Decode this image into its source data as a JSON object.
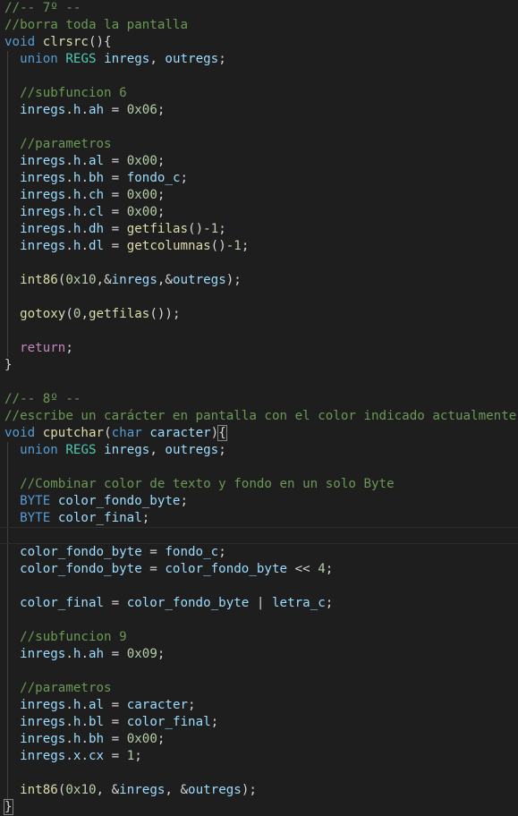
{
  "colors": {
    "background": "#1e1e1e",
    "plain": "#d4d4d4",
    "comment": "#6a9955",
    "keyword": "#569cd6",
    "type": "#4ec9b0",
    "function": "#dcdcaa",
    "variable": "#9cdcfe",
    "number": "#b5cea8",
    "control": "#c586c0"
  },
  "editor": {
    "lines": [
      {
        "tokens": [
          {
            "t": "//-- 7º --",
            "c": "comment"
          }
        ]
      },
      {
        "tokens": [
          {
            "t": "//borra toda la pantalla",
            "c": "comment"
          }
        ]
      },
      {
        "tokens": [
          {
            "t": "void",
            "c": "keyword"
          },
          {
            "t": " ",
            "c": "plain"
          },
          {
            "t": "clrsrc",
            "c": "function"
          },
          {
            "t": "(){",
            "c": "plain"
          }
        ]
      },
      {
        "guide": true,
        "tokens": [
          {
            "t": "  ",
            "c": "plain"
          },
          {
            "t": "union",
            "c": "keyword"
          },
          {
            "t": " ",
            "c": "plain"
          },
          {
            "t": "REGS",
            "c": "type"
          },
          {
            "t": " ",
            "c": "plain"
          },
          {
            "t": "inregs",
            "c": "variable"
          },
          {
            "t": ", ",
            "c": "plain"
          },
          {
            "t": "outregs",
            "c": "variable"
          },
          {
            "t": ";",
            "c": "plain"
          }
        ]
      },
      {
        "guide": true,
        "tokens": []
      },
      {
        "guide": true,
        "tokens": [
          {
            "t": "  ",
            "c": "plain"
          },
          {
            "t": "//subfuncion 6",
            "c": "comment"
          }
        ]
      },
      {
        "guide": true,
        "tokens": [
          {
            "t": "  ",
            "c": "plain"
          },
          {
            "t": "inregs",
            "c": "variable"
          },
          {
            "t": ".",
            "c": "plain"
          },
          {
            "t": "h",
            "c": "variable"
          },
          {
            "t": ".",
            "c": "plain"
          },
          {
            "t": "ah",
            "c": "variable"
          },
          {
            "t": " = ",
            "c": "plain"
          },
          {
            "t": "0x06",
            "c": "number"
          },
          {
            "t": ";",
            "c": "plain"
          }
        ]
      },
      {
        "guide": true,
        "tokens": []
      },
      {
        "guide": true,
        "tokens": [
          {
            "t": "  ",
            "c": "plain"
          },
          {
            "t": "//parametros",
            "c": "comment"
          }
        ]
      },
      {
        "guide": true,
        "tokens": [
          {
            "t": "  ",
            "c": "plain"
          },
          {
            "t": "inregs",
            "c": "variable"
          },
          {
            "t": ".",
            "c": "plain"
          },
          {
            "t": "h",
            "c": "variable"
          },
          {
            "t": ".",
            "c": "plain"
          },
          {
            "t": "al",
            "c": "variable"
          },
          {
            "t": " = ",
            "c": "plain"
          },
          {
            "t": "0x00",
            "c": "number"
          },
          {
            "t": ";",
            "c": "plain"
          }
        ]
      },
      {
        "guide": true,
        "tokens": [
          {
            "t": "  ",
            "c": "plain"
          },
          {
            "t": "inregs",
            "c": "variable"
          },
          {
            "t": ".",
            "c": "plain"
          },
          {
            "t": "h",
            "c": "variable"
          },
          {
            "t": ".",
            "c": "plain"
          },
          {
            "t": "bh",
            "c": "variable"
          },
          {
            "t": " = ",
            "c": "plain"
          },
          {
            "t": "fondo_c",
            "c": "variable"
          },
          {
            "t": ";",
            "c": "plain"
          }
        ]
      },
      {
        "guide": true,
        "tokens": [
          {
            "t": "  ",
            "c": "plain"
          },
          {
            "t": "inregs",
            "c": "variable"
          },
          {
            "t": ".",
            "c": "plain"
          },
          {
            "t": "h",
            "c": "variable"
          },
          {
            "t": ".",
            "c": "plain"
          },
          {
            "t": "ch",
            "c": "variable"
          },
          {
            "t": " = ",
            "c": "plain"
          },
          {
            "t": "0x00",
            "c": "number"
          },
          {
            "t": ";",
            "c": "plain"
          }
        ]
      },
      {
        "guide": true,
        "tokens": [
          {
            "t": "  ",
            "c": "plain"
          },
          {
            "t": "inregs",
            "c": "variable"
          },
          {
            "t": ".",
            "c": "plain"
          },
          {
            "t": "h",
            "c": "variable"
          },
          {
            "t": ".",
            "c": "plain"
          },
          {
            "t": "cl",
            "c": "variable"
          },
          {
            "t": " = ",
            "c": "plain"
          },
          {
            "t": "0x00",
            "c": "number"
          },
          {
            "t": ";",
            "c": "plain"
          }
        ]
      },
      {
        "guide": true,
        "tokens": [
          {
            "t": "  ",
            "c": "plain"
          },
          {
            "t": "inregs",
            "c": "variable"
          },
          {
            "t": ".",
            "c": "plain"
          },
          {
            "t": "h",
            "c": "variable"
          },
          {
            "t": ".",
            "c": "plain"
          },
          {
            "t": "dh",
            "c": "variable"
          },
          {
            "t": " = ",
            "c": "plain"
          },
          {
            "t": "getfilas",
            "c": "function"
          },
          {
            "t": "()-",
            "c": "plain"
          },
          {
            "t": "1",
            "c": "number"
          },
          {
            "t": ";",
            "c": "plain"
          }
        ]
      },
      {
        "guide": true,
        "tokens": [
          {
            "t": "  ",
            "c": "plain"
          },
          {
            "t": "inregs",
            "c": "variable"
          },
          {
            "t": ".",
            "c": "plain"
          },
          {
            "t": "h",
            "c": "variable"
          },
          {
            "t": ".",
            "c": "plain"
          },
          {
            "t": "dl",
            "c": "variable"
          },
          {
            "t": " = ",
            "c": "plain"
          },
          {
            "t": "getcolumnas",
            "c": "function"
          },
          {
            "t": "()-",
            "c": "plain"
          },
          {
            "t": "1",
            "c": "number"
          },
          {
            "t": ";",
            "c": "plain"
          }
        ]
      },
      {
        "guide": true,
        "tokens": []
      },
      {
        "guide": true,
        "tokens": [
          {
            "t": "  ",
            "c": "plain"
          },
          {
            "t": "int86",
            "c": "function"
          },
          {
            "t": "(",
            "c": "plain"
          },
          {
            "t": "0x10",
            "c": "number"
          },
          {
            "t": ",&",
            "c": "plain"
          },
          {
            "t": "inregs",
            "c": "variable"
          },
          {
            "t": ",&",
            "c": "plain"
          },
          {
            "t": "outregs",
            "c": "variable"
          },
          {
            "t": ");",
            "c": "plain"
          }
        ]
      },
      {
        "guide": true,
        "tokens": []
      },
      {
        "guide": true,
        "tokens": [
          {
            "t": "  ",
            "c": "plain"
          },
          {
            "t": "gotoxy",
            "c": "function"
          },
          {
            "t": "(",
            "c": "plain"
          },
          {
            "t": "0",
            "c": "number"
          },
          {
            "t": ",",
            "c": "plain"
          },
          {
            "t": "getfilas",
            "c": "function"
          },
          {
            "t": "());",
            "c": "plain"
          }
        ]
      },
      {
        "guide": true,
        "tokens": []
      },
      {
        "guide": true,
        "tokens": [
          {
            "t": "  ",
            "c": "plain"
          },
          {
            "t": "return",
            "c": "control"
          },
          {
            "t": ";",
            "c": "plain"
          }
        ]
      },
      {
        "tokens": [
          {
            "t": "}",
            "c": "plain"
          }
        ]
      },
      {
        "tokens": []
      },
      {
        "tokens": [
          {
            "t": "//-- 8º --",
            "c": "comment"
          }
        ]
      },
      {
        "tokens": [
          {
            "t": "//escribe un carácter en pantalla con el color indicado actualmente",
            "c": "comment"
          }
        ]
      },
      {
        "tokens": [
          {
            "t": "void",
            "c": "keyword"
          },
          {
            "t": " ",
            "c": "plain"
          },
          {
            "t": "cputchar",
            "c": "function"
          },
          {
            "t": "(",
            "c": "plain"
          },
          {
            "t": "char",
            "c": "keyword"
          },
          {
            "t": " ",
            "c": "plain"
          },
          {
            "t": "caracter",
            "c": "variable"
          },
          {
            "t": ")",
            "c": "plain"
          },
          {
            "t": "{",
            "c": "plain",
            "match": true
          }
        ]
      },
      {
        "guide": true,
        "tokens": [
          {
            "t": "  ",
            "c": "plain"
          },
          {
            "t": "union",
            "c": "keyword"
          },
          {
            "t": " ",
            "c": "plain"
          },
          {
            "t": "REGS",
            "c": "type"
          },
          {
            "t": " ",
            "c": "plain"
          },
          {
            "t": "inregs",
            "c": "variable"
          },
          {
            "t": ", ",
            "c": "plain"
          },
          {
            "t": "outregs",
            "c": "variable"
          },
          {
            "t": ";",
            "c": "plain"
          }
        ]
      },
      {
        "guide": true,
        "tokens": []
      },
      {
        "guide": true,
        "tokens": [
          {
            "t": "  ",
            "c": "plain"
          },
          {
            "t": "//Combinar color de texto y fondo en un solo Byte",
            "c": "comment"
          }
        ]
      },
      {
        "guide": true,
        "tokens": [
          {
            "t": "  ",
            "c": "plain"
          },
          {
            "t": "BYTE",
            "c": "keyword"
          },
          {
            "t": " ",
            "c": "plain"
          },
          {
            "t": "color_fondo_byte",
            "c": "variable"
          },
          {
            "t": ";",
            "c": "plain"
          }
        ]
      },
      {
        "guide": true,
        "tokens": [
          {
            "t": "  ",
            "c": "plain"
          },
          {
            "t": "BYTE",
            "c": "keyword"
          },
          {
            "t": " ",
            "c": "plain"
          },
          {
            "t": "color_final",
            "c": "variable"
          },
          {
            "t": ";",
            "c": "plain"
          }
        ]
      },
      {
        "guide": true,
        "current": true,
        "tokens": []
      },
      {
        "guide": true,
        "tokens": [
          {
            "t": "  ",
            "c": "plain"
          },
          {
            "t": "color_fondo_byte",
            "c": "variable"
          },
          {
            "t": " = ",
            "c": "plain"
          },
          {
            "t": "fondo_c",
            "c": "variable"
          },
          {
            "t": ";",
            "c": "plain"
          }
        ]
      },
      {
        "guide": true,
        "tokens": [
          {
            "t": "  ",
            "c": "plain"
          },
          {
            "t": "color_fondo_byte",
            "c": "variable"
          },
          {
            "t": " = ",
            "c": "plain"
          },
          {
            "t": "color_fondo_byte",
            "c": "variable"
          },
          {
            "t": " << ",
            "c": "plain"
          },
          {
            "t": "4",
            "c": "number"
          },
          {
            "t": ";",
            "c": "plain"
          }
        ]
      },
      {
        "guide": true,
        "tokens": []
      },
      {
        "guide": true,
        "tokens": [
          {
            "t": "  ",
            "c": "plain"
          },
          {
            "t": "color_final",
            "c": "variable"
          },
          {
            "t": " = ",
            "c": "plain"
          },
          {
            "t": "color_fondo_byte",
            "c": "variable"
          },
          {
            "t": " | ",
            "c": "plain"
          },
          {
            "t": "letra_c",
            "c": "variable"
          },
          {
            "t": ";",
            "c": "plain"
          }
        ]
      },
      {
        "guide": true,
        "tokens": []
      },
      {
        "guide": true,
        "tokens": [
          {
            "t": "  ",
            "c": "plain"
          },
          {
            "t": "//subfuncion 9",
            "c": "comment"
          }
        ]
      },
      {
        "guide": true,
        "tokens": [
          {
            "t": "  ",
            "c": "plain"
          },
          {
            "t": "inregs",
            "c": "variable"
          },
          {
            "t": ".",
            "c": "plain"
          },
          {
            "t": "h",
            "c": "variable"
          },
          {
            "t": ".",
            "c": "plain"
          },
          {
            "t": "ah",
            "c": "variable"
          },
          {
            "t": " = ",
            "c": "plain"
          },
          {
            "t": "0x09",
            "c": "number"
          },
          {
            "t": ";",
            "c": "plain"
          }
        ]
      },
      {
        "guide": true,
        "tokens": []
      },
      {
        "guide": true,
        "tokens": [
          {
            "t": "  ",
            "c": "plain"
          },
          {
            "t": "//parametros",
            "c": "comment"
          }
        ]
      },
      {
        "guide": true,
        "tokens": [
          {
            "t": "  ",
            "c": "plain"
          },
          {
            "t": "inregs",
            "c": "variable"
          },
          {
            "t": ".",
            "c": "plain"
          },
          {
            "t": "h",
            "c": "variable"
          },
          {
            "t": ".",
            "c": "plain"
          },
          {
            "t": "al",
            "c": "variable"
          },
          {
            "t": " = ",
            "c": "plain"
          },
          {
            "t": "caracter",
            "c": "variable"
          },
          {
            "t": ";",
            "c": "plain"
          }
        ]
      },
      {
        "guide": true,
        "tokens": [
          {
            "t": "  ",
            "c": "plain"
          },
          {
            "t": "inregs",
            "c": "variable"
          },
          {
            "t": ".",
            "c": "plain"
          },
          {
            "t": "h",
            "c": "variable"
          },
          {
            "t": ".",
            "c": "plain"
          },
          {
            "t": "bl",
            "c": "variable"
          },
          {
            "t": " = ",
            "c": "plain"
          },
          {
            "t": "color_final",
            "c": "variable"
          },
          {
            "t": ";",
            "c": "plain"
          }
        ]
      },
      {
        "guide": true,
        "tokens": [
          {
            "t": "  ",
            "c": "plain"
          },
          {
            "t": "inregs",
            "c": "variable"
          },
          {
            "t": ".",
            "c": "plain"
          },
          {
            "t": "h",
            "c": "variable"
          },
          {
            "t": ".",
            "c": "plain"
          },
          {
            "t": "bh",
            "c": "variable"
          },
          {
            "t": " = ",
            "c": "plain"
          },
          {
            "t": "0x00",
            "c": "number"
          },
          {
            "t": ";",
            "c": "plain"
          }
        ]
      },
      {
        "guide": true,
        "tokens": [
          {
            "t": "  ",
            "c": "plain"
          },
          {
            "t": "inregs",
            "c": "variable"
          },
          {
            "t": ".",
            "c": "plain"
          },
          {
            "t": "x",
            "c": "variable"
          },
          {
            "t": ".",
            "c": "plain"
          },
          {
            "t": "cx",
            "c": "variable"
          },
          {
            "t": " = ",
            "c": "plain"
          },
          {
            "t": "1",
            "c": "number"
          },
          {
            "t": ";",
            "c": "plain"
          }
        ]
      },
      {
        "guide": true,
        "tokens": []
      },
      {
        "guide": true,
        "tokens": [
          {
            "t": "  ",
            "c": "plain"
          },
          {
            "t": "int86",
            "c": "function"
          },
          {
            "t": "(",
            "c": "plain"
          },
          {
            "t": "0x10",
            "c": "number"
          },
          {
            "t": ", &",
            "c": "plain"
          },
          {
            "t": "inregs",
            "c": "variable"
          },
          {
            "t": ", &",
            "c": "plain"
          },
          {
            "t": "outregs",
            "c": "variable"
          },
          {
            "t": ");",
            "c": "plain"
          }
        ]
      },
      {
        "tokens": [
          {
            "t": "}",
            "c": "plain",
            "match": true
          }
        ]
      }
    ]
  }
}
